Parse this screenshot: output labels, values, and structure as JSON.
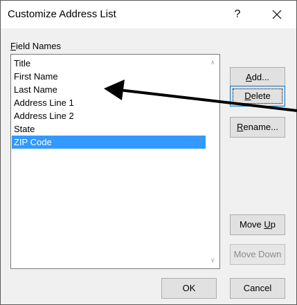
{
  "window": {
    "title": "Customize Address List",
    "help_label": "?"
  },
  "field_names": {
    "label_mnemonic": "F",
    "label_rest": "ield Names",
    "items": [
      "Title",
      "First Name",
      "Last Name",
      "Address Line 1",
      "Address Line 2",
      "State",
      "ZIP Code"
    ],
    "selected_index": 6
  },
  "buttons": {
    "add": {
      "mnemonic": "A",
      "rest": "dd..."
    },
    "delete": {
      "mnemonic": "D",
      "rest": "elete"
    },
    "rename": {
      "mnemonic": "R",
      "rest": "ename..."
    },
    "move_up": {
      "pre": "Move ",
      "mnemonic": "U",
      "rest": "p"
    },
    "move_down": {
      "label": "Move Down"
    },
    "ok": {
      "label": "OK"
    },
    "cancel": {
      "label": "Cancel"
    }
  },
  "colors": {
    "selection": "#3399ff",
    "default_border": "#0078d7"
  }
}
